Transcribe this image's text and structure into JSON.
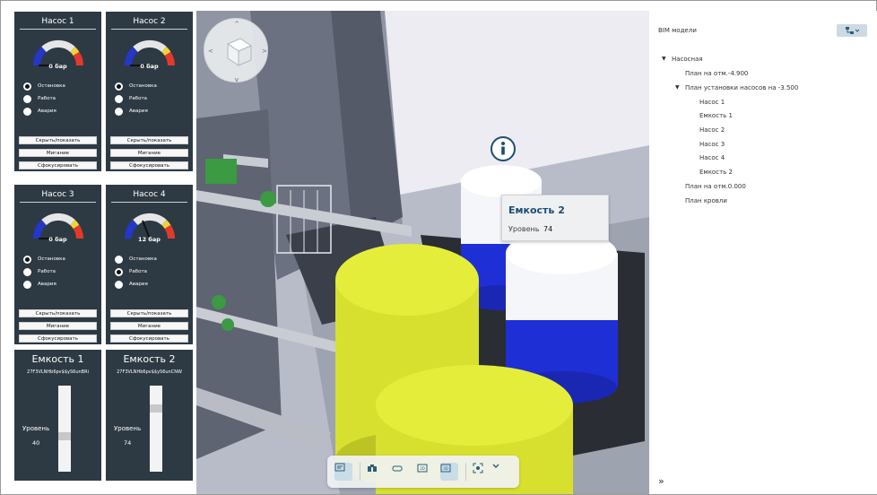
{
  "pumps": [
    {
      "title": "Насос 1",
      "value": "0 бар",
      "needle_fraction": 0.0,
      "state_labels": [
        "Остановка",
        "Работа",
        "Авария"
      ],
      "selected": 0,
      "buttons": [
        "Скрыть/показать",
        "Мигание",
        "Сфокусировать"
      ]
    },
    {
      "title": "Насос 2",
      "value": "0 бар",
      "needle_fraction": 0.0,
      "state_labels": [
        "Остановка",
        "Работа",
        "Авария"
      ],
      "selected": 0,
      "buttons": [
        "Скрыть/показать",
        "Мигание",
        "Сфокусировать"
      ]
    },
    {
      "title": "Насос 3",
      "value": "0 бар",
      "needle_fraction": 0.0,
      "state_labels": [
        "Остановка",
        "Работа",
        "Авария"
      ],
      "selected": 0,
      "buttons": [
        "Скрыть/показать",
        "Мигание",
        "Сфокусировать"
      ]
    },
    {
      "title": "Насос 4",
      "value": "12 бар",
      "needle_fraction": 0.4,
      "state_labels": [
        "Остановка",
        "Работа",
        "Авария"
      ],
      "selected": 1,
      "buttons": [
        "Скрыть/показать",
        "Мигание",
        "Сфокусировать"
      ]
    }
  ],
  "tanks": [
    {
      "title": "Емкость 1",
      "id": "27F3VLNHb6pv$$yS6unBRi",
      "level_label": "Уровень",
      "level_value": "40",
      "level_fraction": 0.4
    },
    {
      "title": "Емкость 2",
      "id": "27F3VLNHb6pv$$yS6unCNW",
      "level_label": "Уровень",
      "level_value": "74",
      "level_fraction": 0.74
    }
  ],
  "scene": {
    "tooltip": {
      "title": "Емкость 2",
      "label": "Уровень",
      "value": "74"
    },
    "info_icon": "info-icon",
    "toolbar": [
      "comment-icon",
      "binoculars-icon",
      "controller-icon",
      "2d-icon",
      "3d-icon",
      "focus-icon",
      "chevron-down-icon"
    ]
  },
  "tree": {
    "title": "BIM модели",
    "items": [
      {
        "label": "Насосная"
      },
      {
        "label": "План на отм.-4.900"
      },
      {
        "label": "План установки насосов на -3.500"
      },
      {
        "label": "Насос 1"
      },
      {
        "label": "Емкость 1"
      },
      {
        "label": "Насос 2"
      },
      {
        "label": "Насос 3"
      },
      {
        "label": "Насос 4"
      },
      {
        "label": "Емкость 2"
      },
      {
        "label": "План на отм.0.000"
      },
      {
        "label": "План кровли"
      }
    ]
  },
  "colors": {
    "panel": "#2d3a44",
    "accent": "#2b5d7a",
    "tank_yellow": "#e4ee3a",
    "tank_blue": "#1f2fd6"
  }
}
